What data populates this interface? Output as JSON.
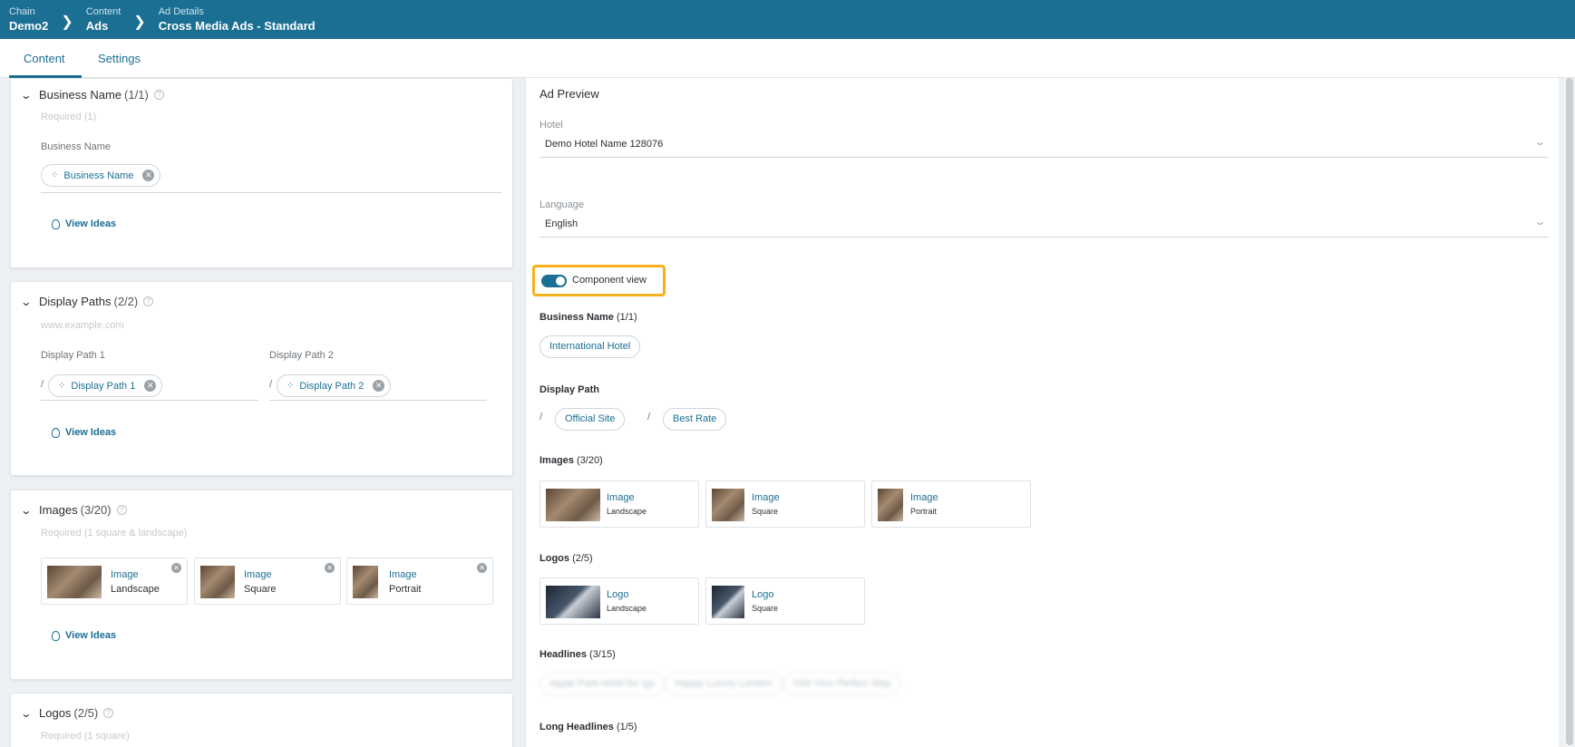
{
  "breadcrumbs": [
    {
      "label": "Chain",
      "value": "Demo2"
    },
    {
      "label": "Content",
      "value": "Ads"
    },
    {
      "label": "Ad Details",
      "value": "Cross Media Ads - Standard"
    }
  ],
  "tabs": {
    "content": "Content",
    "settings": "Settings"
  },
  "left": {
    "business_name": {
      "title": "Business Name",
      "count": "(1/1)",
      "sub": "Required (1)",
      "field_label": "Business Name",
      "chip": "Business Name",
      "view_ideas": "View Ideas"
    },
    "display_paths": {
      "title": "Display Paths",
      "count": "(2/2)",
      "sub": "www.example.com",
      "label1": "Display Path 1",
      "label2": "Display Path 2",
      "chip1": "Display Path 1",
      "chip2": "Display Path 2",
      "slash": "/",
      "view_ideas": "View Ideas"
    },
    "images": {
      "title": "Images",
      "count": "(3/20)",
      "sub": "Required (1 square & landscape)",
      "tiles": [
        {
          "title": "Image",
          "type": "Landscape"
        },
        {
          "title": "Image",
          "type": "Square"
        },
        {
          "title": "Image",
          "type": "Portrait"
        }
      ],
      "view_ideas": "View Ideas"
    },
    "logos": {
      "title": "Logos",
      "count": "(2/5)",
      "sub": "Required (1 square)"
    }
  },
  "preview": {
    "title": "Ad Preview",
    "hotel_label": "Hotel",
    "hotel_value": "Demo Hotel Name 128076",
    "language_label": "Language",
    "language_value": "English",
    "toggle_label": "Component view",
    "business_name": {
      "title": "Business Name",
      "count": "(1/1)",
      "pill": "International Hotel"
    },
    "display_path": {
      "title": "Display Path",
      "slash": "/",
      "pills": [
        "Official Site",
        "Best Rate"
      ]
    },
    "images": {
      "title": "Images",
      "count": "(3/20)",
      "tiles": [
        {
          "title": "Image",
          "type": "Landscape"
        },
        {
          "title": "Image",
          "type": "Square"
        },
        {
          "title": "Image",
          "type": "Portrait"
        }
      ]
    },
    "logos": {
      "title": "Logos",
      "count": "(2/5)",
      "tiles": [
        {
          "title": "Logo",
          "type": "Landscape"
        },
        {
          "title": "Logo",
          "type": "Square"
        }
      ]
    },
    "headlines": {
      "title": "Headlines",
      "count": "(3/15)",
      "pills": [
        "Apple Park Hotel for Igo",
        "Happy Luxury London",
        "Visit Your Perfect Stay"
      ]
    },
    "long_headlines": {
      "title": "Long Headlines",
      "count": "(1/5)"
    }
  },
  "colors": {
    "brand": "#1b6f93",
    "highlight": "#f5b01c"
  }
}
